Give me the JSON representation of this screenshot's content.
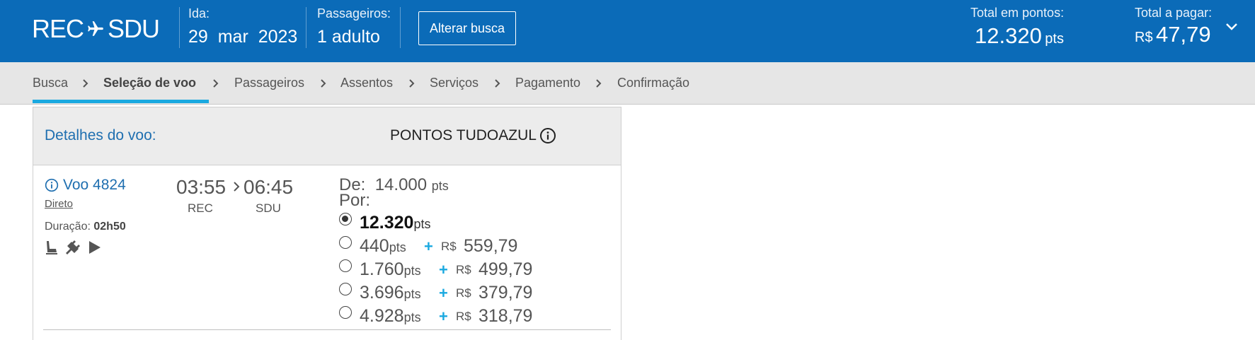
{
  "header": {
    "origin": "REC",
    "destination": "SDU",
    "ida_label": "Ida:",
    "ida_day": "29",
    "ida_month": "mar",
    "ida_year": "2023",
    "passageiros_label": "Passageiros:",
    "passageiros_value": "1 adulto",
    "alterar_label": "Alterar busca",
    "total_pontos_label": "Total em pontos:",
    "total_pontos_value": "12.320",
    "total_pontos_unit": "pts",
    "total_pagar_label": "Total a pagar:",
    "total_pagar_currency": "R$",
    "total_pagar_value": "47,79"
  },
  "steps": [
    {
      "label": "Busca"
    },
    {
      "label": "Seleção de voo"
    },
    {
      "label": "Passageiros"
    },
    {
      "label": "Assentos"
    },
    {
      "label": "Serviços"
    },
    {
      "label": "Pagamento"
    },
    {
      "label": "Confirmação"
    }
  ],
  "card": {
    "detalhes_title": "Detalhes do voo:",
    "pontos_title": "PONTOS TUDOAZUL",
    "flight_label": "Voo 4824",
    "direto": "Direto",
    "duracao_label": "Duração:",
    "duracao_value": "02h50",
    "depart_time": "03:55",
    "arrive_time": "06:45",
    "depart_code": "REC",
    "arrive_code": "SDU",
    "de_label": "De:",
    "de_value": "14.000",
    "por_label": "Por:",
    "pts_unit": "pts",
    "currency": "R$",
    "plus": "+",
    "options": [
      {
        "points": "12.320",
        "money": "",
        "selected": true
      },
      {
        "points": "440",
        "money": "559,79",
        "selected": false
      },
      {
        "points": "1.760",
        "money": "499,79",
        "selected": false
      },
      {
        "points": "3.696",
        "money": "379,79",
        "selected": false
      },
      {
        "points": "4.928",
        "money": "318,79",
        "selected": false
      }
    ],
    "amenities": [
      "seat-icon",
      "power-plug-icon",
      "play-icon"
    ]
  }
}
